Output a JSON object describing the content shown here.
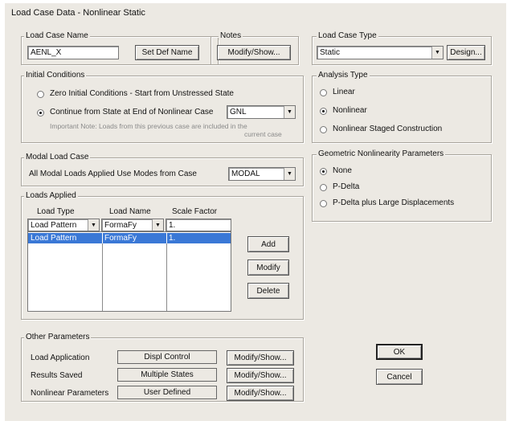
{
  "window": {
    "title": "Load Case Data - Nonlinear Static"
  },
  "load_case_name": {
    "label": "Load Case Name",
    "value": "AENL_X",
    "set_def_button": "Set Def Name"
  },
  "notes": {
    "label": "Notes",
    "button": "Modify/Show..."
  },
  "load_case_type": {
    "label": "Load Case Type",
    "value": "Static",
    "design_button": "Design..."
  },
  "initial_conditions": {
    "label": "Initial Conditions",
    "option_zero": "Zero Initial Conditions - Start from Unstressed State",
    "option_continue": "Continue from State at End of Nonlinear Case",
    "continue_case": "GNL",
    "note_line1": "Important Note:   Loads from this previous case are included in the",
    "note_line2": "current case",
    "selected": "continue"
  },
  "modal_load_case": {
    "label": "Modal Load Case",
    "text": "All Modal Loads Applied Use Modes from Case",
    "value": "MODAL"
  },
  "analysis_type": {
    "label": "Analysis Type",
    "options": [
      "Linear",
      "Nonlinear",
      "Nonlinear Staged Construction"
    ],
    "selected": "Nonlinear"
  },
  "geometric_nonlinearity": {
    "label": "Geometric Nonlinearity Parameters",
    "options": [
      "None",
      "P-Delta",
      "P-Delta plus Large Displacements"
    ],
    "selected": "None"
  },
  "loads_applied": {
    "label": "Loads Applied",
    "headers": [
      "Load Type",
      "Load Name",
      "Scale Factor"
    ],
    "edit_row": {
      "load_type": "Load Pattern",
      "load_name": "FormaFy",
      "scale_factor": "1."
    },
    "rows": [
      {
        "load_type": "Load Pattern",
        "load_name": "FormaFy",
        "scale_factor": "1."
      }
    ],
    "buttons": {
      "add": "Add",
      "modify": "Modify",
      "delete": "Delete"
    }
  },
  "other_parameters": {
    "label": "Other Parameters",
    "rows": [
      {
        "label": "Load Application",
        "value": "Displ Control",
        "button": "Modify/Show..."
      },
      {
        "label": "Results Saved",
        "value": "Multiple States",
        "button": "Modify/Show..."
      },
      {
        "label": "Nonlinear Parameters",
        "value": "User Defined",
        "button": "Modify/Show..."
      }
    ]
  },
  "dialog_buttons": {
    "ok": "OK",
    "cancel": "Cancel"
  }
}
